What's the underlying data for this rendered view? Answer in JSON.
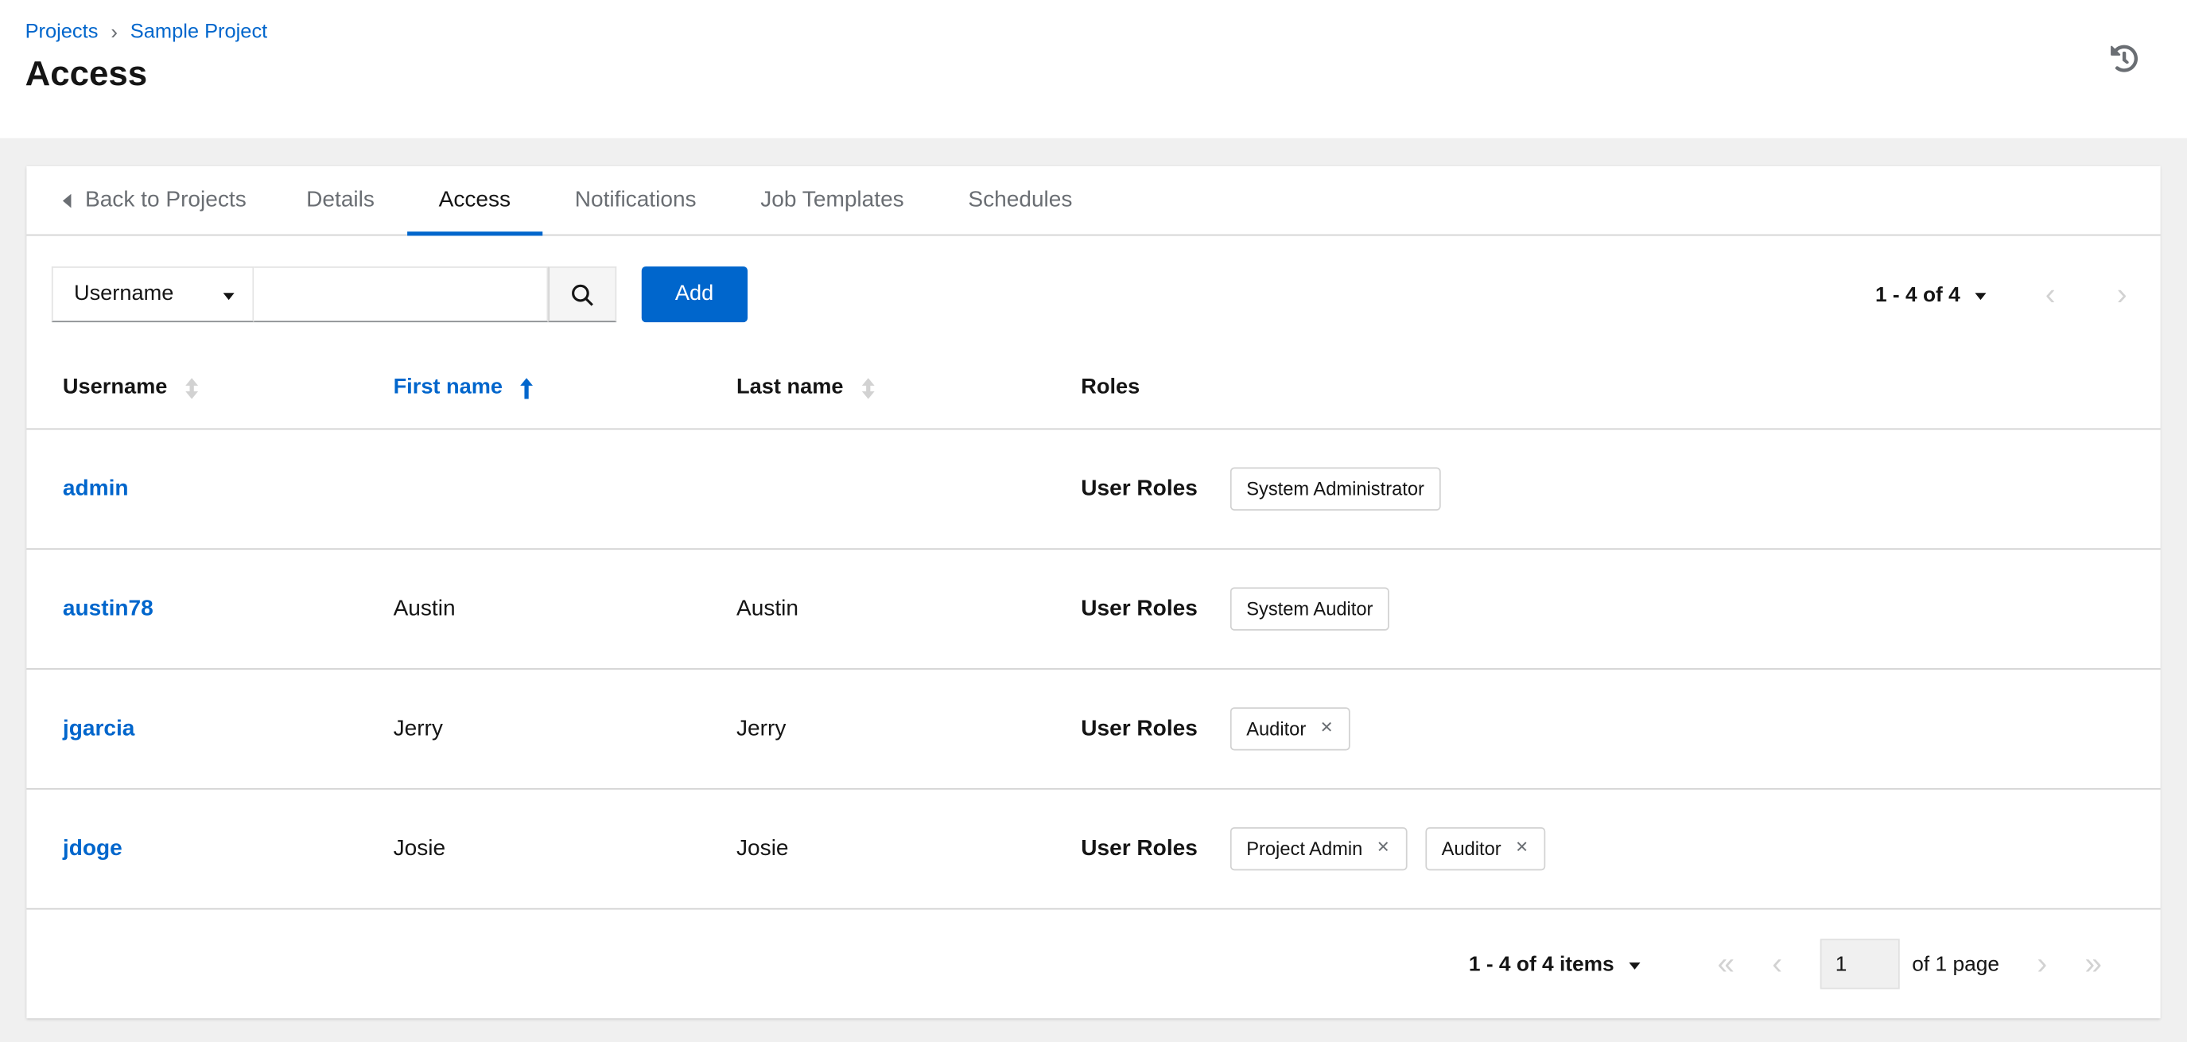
{
  "breadcrumb": {
    "projects": "Projects",
    "current": "Sample Project"
  },
  "page": {
    "title": "Access"
  },
  "icons": {
    "breadcrumb_separator": "›",
    "chevron_left": "‹",
    "chevron_right": "›",
    "chevron_double_left": "«",
    "chevron_double_right": "»",
    "close": "✕"
  },
  "tabs": {
    "back": "Back to Projects",
    "items": [
      {
        "label": "Details",
        "active": false
      },
      {
        "label": "Access",
        "active": true
      },
      {
        "label": "Notifications",
        "active": false
      },
      {
        "label": "Job Templates",
        "active": false
      },
      {
        "label": "Schedules",
        "active": false
      }
    ]
  },
  "toolbar": {
    "filter": {
      "selected": "Username"
    },
    "search": {
      "value": "",
      "placeholder": ""
    },
    "add_label": "Add",
    "pagination": {
      "range_label": "1 - 4 of 4"
    }
  },
  "table": {
    "columns": [
      {
        "label": "Username",
        "sort": "none"
      },
      {
        "label": "First name",
        "sort": "asc"
      },
      {
        "label": "Last name",
        "sort": "none"
      },
      {
        "label": "Roles",
        "sort": null
      }
    ],
    "rows": [
      {
        "username": "admin",
        "first_name": "",
        "last_name": "",
        "roles_label": "User Roles",
        "chips": [
          {
            "label": "System Administrator",
            "removable": false
          }
        ]
      },
      {
        "username": "austin78",
        "first_name": "Austin",
        "last_name": "Austin",
        "roles_label": "User Roles",
        "chips": [
          {
            "label": "System Auditor",
            "removable": false
          }
        ]
      },
      {
        "username": "jgarcia",
        "first_name": "Jerry",
        "last_name": "Jerry",
        "roles_label": "User Roles",
        "chips": [
          {
            "label": "Auditor",
            "removable": true
          }
        ]
      },
      {
        "username": "jdoge",
        "first_name": "Josie",
        "last_name": "Josie",
        "roles_label": "User Roles",
        "chips": [
          {
            "label": "Project Admin",
            "removable": true
          },
          {
            "label": "Auditor",
            "removable": true
          }
        ]
      }
    ]
  },
  "footer": {
    "items_label": "1 - 4 of 4 items",
    "page_value": "1",
    "page_count_label": "of 1 page"
  },
  "colors": {
    "link_blue": "#0066cc",
    "text_dark": "#151515",
    "text_gray": "#6a6e73",
    "border": "#d2d2d2",
    "bg_gray": "#f0f0f0"
  }
}
